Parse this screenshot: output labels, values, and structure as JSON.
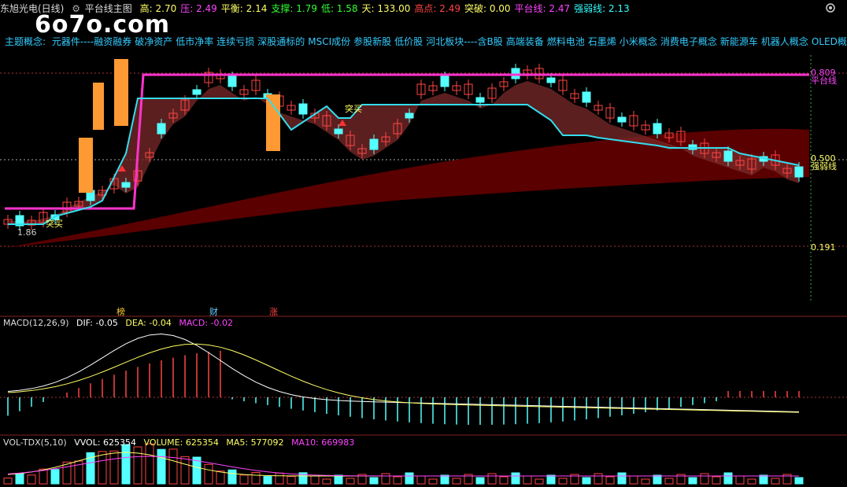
{
  "header": {
    "title": "东旭光电(日线)",
    "indicator": "平台线主图",
    "stats": [
      {
        "label": "高:",
        "value": "2.70",
        "color": "#ffff66"
      },
      {
        "label": "压:",
        "value": "2.49",
        "color": "#ff44ff"
      },
      {
        "label": "平衡:",
        "value": "2.14",
        "color": "#ffff66"
      },
      {
        "label": "支撑:",
        "value": "1.79",
        "color": "#33ff33"
      },
      {
        "label": "低:",
        "value": "1.58",
        "color": "#33ff33"
      },
      {
        "label": "天:",
        "value": "133.00",
        "color": "#ffff66"
      },
      {
        "label": "高点:",
        "value": "2.49",
        "color": "#ff4444"
      },
      {
        "label": "突破:",
        "value": "0.00",
        "color": "#ffff66"
      },
      {
        "label": "平台线:",
        "value": "2.47",
        "color": "#ff44ff"
      },
      {
        "label": "强弱线:",
        "value": "2.13",
        "color": "#33ffff"
      }
    ]
  },
  "logo_text": "6o7o.com",
  "concepts": {
    "label": "主题概念:",
    "items": [
      "元器件----融资融券",
      "破净资产",
      "低市净率",
      "连续亏损",
      "深股通标的",
      "MSCI成份",
      "参股新股",
      "低价股",
      "河北板块----含B股",
      "高端装备",
      "燃料电池",
      "石墨烯",
      "小米概念",
      "消费电子概念",
      "新能源车",
      "机器人概念",
      "OLED概念"
    ]
  },
  "price_labels": {
    "top_line": "0.809",
    "top_line_name": "平台线",
    "mid_line": "0.500",
    "mid_line_name": "强弱线",
    "bottom_line": "0.191",
    "low_mark": "1.86",
    "signal_buy": "突买",
    "signal_buy2": "突买"
  },
  "markers": [
    {
      "text": "榜",
      "color": "#ffcc33"
    },
    {
      "text": "财",
      "color": "#66ccff"
    },
    {
      "text": "涨",
      "color": "#ff4444"
    }
  ],
  "macd": {
    "name": "MACD(12,26,9)",
    "dif_label": "DIF:",
    "dif": "-0.05",
    "dea_label": "DEA:",
    "dea": "-0.04",
    "macd_label": "MACD:",
    "macd": "-0.02"
  },
  "vol": {
    "name": "VOL-TDX(5,10)",
    "vvol_label": "VVOL:",
    "vvol": "625354",
    "volume_label": "VOLUME:",
    "volume": "625354",
    "ma5_label": "MA5:",
    "ma5": "577092",
    "ma10_label": "MA10:",
    "ma10": "669983"
  },
  "colors": {
    "up": "#ff4444",
    "down": "#54ffff",
    "platform": "#ff33cc",
    "strength": "#33ddee",
    "fill": "#ff9933",
    "band": "#5a0000"
  }
}
